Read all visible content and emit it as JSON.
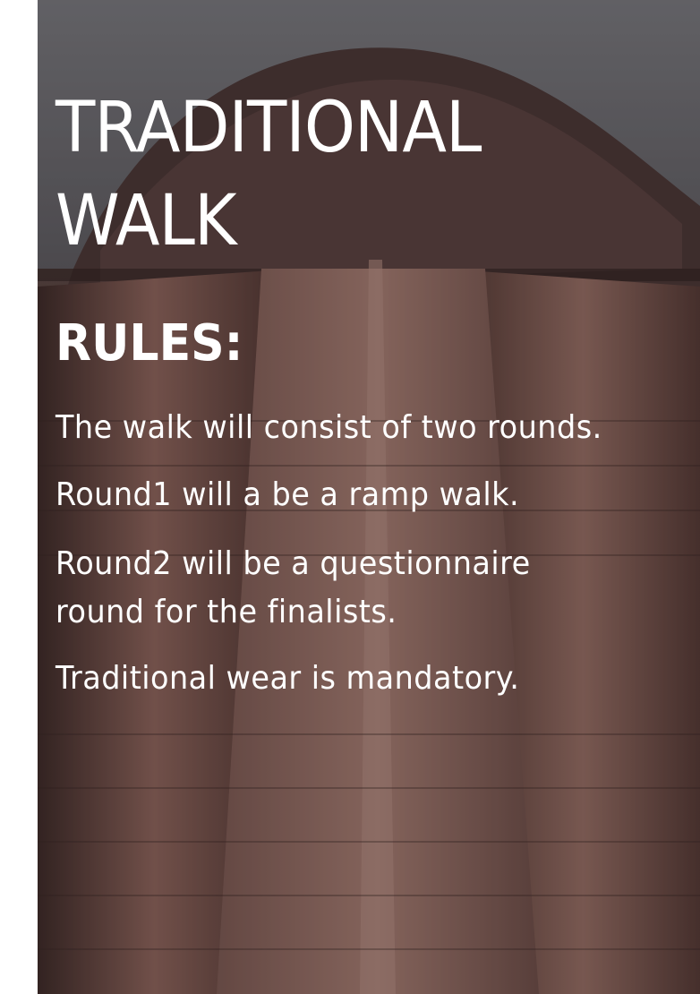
{
  "poster": {
    "title_line1": "TRADITIONAL",
    "title_line2": "WALK",
    "rules_heading": "RULES:",
    "rules": [
      "The walk will consist of two rounds.",
      "Round1 will a be a ramp walk.",
      "Round2 will be a questionnaire",
      "round for the finalists.",
      "Traditional wear is mandatory."
    ],
    "background_image": "sandstone minaret tower viewed from below",
    "colors": {
      "text": "#ffffff",
      "sky": "#6d6c70",
      "stone": "#6a4a44"
    }
  }
}
